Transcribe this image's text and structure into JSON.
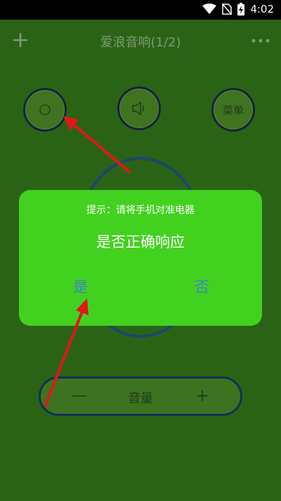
{
  "status_bar": {
    "time": "4:02",
    "icons": [
      "wifi-icon",
      "no-sim-icon",
      "battery-charging-icon"
    ]
  },
  "app_bar": {
    "title": "爱浪音响(1/2)",
    "left_icon": "plus-icon",
    "right_icon": "more-icon"
  },
  "controls": {
    "power_icon": "power-icon",
    "mute_icon": "speaker-icon",
    "menu_label": "菜单"
  },
  "volume": {
    "minus": "—",
    "label": "音量",
    "plus": "+"
  },
  "dialog": {
    "hint": "提示：请将手机对准电器",
    "question": "是否正确响应",
    "yes_label": "是",
    "no_label": "否"
  },
  "colors": {
    "background": "#2b6316",
    "dialog": "#43d120",
    "button_text": "#3b86c8",
    "annotation_arrow": "#e01818"
  }
}
